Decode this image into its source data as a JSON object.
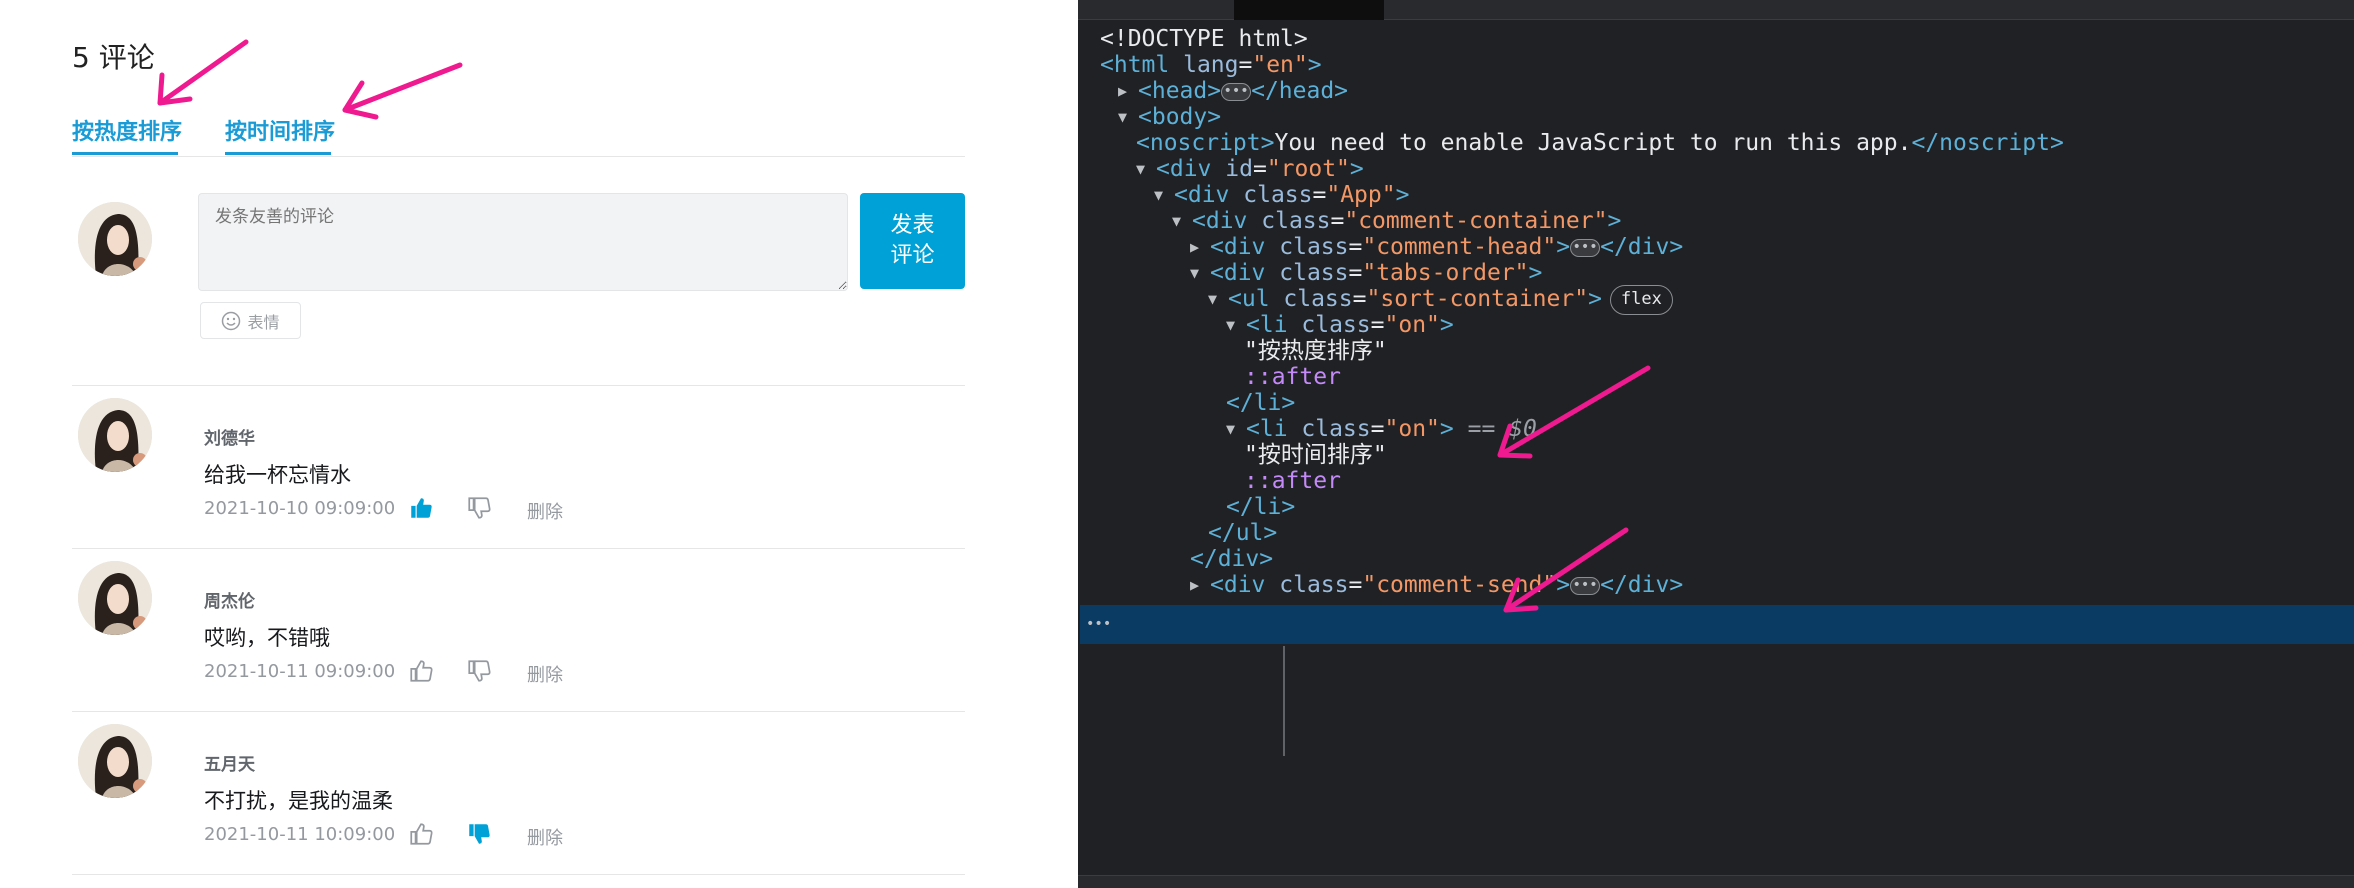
{
  "comment_section": {
    "count_label": "5 评论",
    "tabs": [
      {
        "label": "按热度排序"
      },
      {
        "label": "按时间排序"
      }
    ],
    "input": {
      "placeholder": "发条友善的评论"
    },
    "publish_label": "发表\n评论",
    "emoji_label": "表情",
    "delete_label": "删除",
    "comments": [
      {
        "user": "刘德华",
        "text": "给我一杯忘情水",
        "time": "2021-10-10 09:09:00",
        "liked": true,
        "disliked": false
      },
      {
        "user": "周杰伦",
        "text": "哎哟，不错哦",
        "time": "2021-10-11 09:09:00",
        "liked": false,
        "disliked": false
      },
      {
        "user": "五月天",
        "text": "不打扰，是我的温柔",
        "time": "2021-10-11 10:09:00",
        "liked": false,
        "disliked": true
      }
    ],
    "accent_color": "#00a1d6"
  },
  "devtools": {
    "lines": [
      [
        [
          "p",
          "<!DOCTYPE html>"
        ]
      ],
      [
        [
          "t",
          "<html "
        ],
        [
          "n",
          "lang"
        ],
        [
          "p",
          "="
        ],
        [
          "v",
          "\"en\""
        ],
        [
          "t",
          ">"
        ]
      ],
      [
        [
          "t",
          "<head>"
        ],
        [
          "d",
          "…"
        ],
        [
          "t",
          "</head>"
        ]
      ],
      [
        [
          "t",
          "<body>"
        ]
      ],
      [
        [
          "t",
          "<noscript>"
        ],
        [
          "p",
          "You need to enable JavaScript to run this app."
        ],
        [
          "t",
          "</noscript>"
        ]
      ],
      [
        [
          "t",
          "<div "
        ],
        [
          "n",
          "id"
        ],
        [
          "p",
          "="
        ],
        [
          "v",
          "\"root\""
        ],
        [
          "t",
          ">"
        ]
      ],
      [
        [
          "t",
          "<div "
        ],
        [
          "n",
          "class"
        ],
        [
          "p",
          "="
        ],
        [
          "v",
          "\"App\""
        ],
        [
          "t",
          ">"
        ]
      ],
      [
        [
          "t",
          "<div "
        ],
        [
          "n",
          "class"
        ],
        [
          "p",
          "="
        ],
        [
          "v",
          "\"comment-container\""
        ],
        [
          "t",
          ">"
        ]
      ],
      [
        [
          "t",
          "<div "
        ],
        [
          "n",
          "class"
        ],
        [
          "p",
          "="
        ],
        [
          "v",
          "\"comment-head\""
        ],
        [
          "t",
          ">"
        ],
        [
          "d",
          "…"
        ],
        [
          "t",
          "</div>"
        ]
      ],
      [
        [
          "t",
          "<div "
        ],
        [
          "n",
          "class"
        ],
        [
          "p",
          "="
        ],
        [
          "v",
          "\"tabs-order\""
        ],
        [
          "t",
          ">"
        ]
      ],
      [
        [
          "t",
          "<ul "
        ],
        [
          "n",
          "class"
        ],
        [
          "p",
          "="
        ],
        [
          "v",
          "\"sort-container\""
        ],
        [
          "t",
          ">"
        ],
        [
          "b",
          "flex"
        ]
      ],
      [
        [
          "t",
          "<li "
        ],
        [
          "n",
          "class"
        ],
        [
          "p",
          "="
        ],
        [
          "v",
          "\"on\""
        ],
        [
          "t",
          ">"
        ]
      ],
      [
        [
          "p",
          "\"按热度排序\""
        ]
      ],
      [
        [
          "s",
          "::after"
        ]
      ],
      [
        [
          "t",
          "</li>"
        ]
      ],
      [
        [
          "t",
          "<li "
        ],
        [
          "n",
          "class"
        ],
        [
          "p",
          "="
        ],
        [
          "v",
          "\"on\""
        ],
        [
          "t",
          ">"
        ],
        [
          "c",
          " == $0"
        ]
      ],
      [
        [
          "p",
          "\"按时间排序\""
        ]
      ],
      [
        [
          "s",
          "::after"
        ]
      ],
      [
        [
          "t",
          "</li>"
        ]
      ],
      [
        [
          "t",
          "</ul>"
        ]
      ],
      [
        [
          "t",
          "</div>"
        ]
      ],
      [
        [
          "t",
          "<div "
        ],
        [
          "n",
          "class"
        ],
        [
          "p",
          "="
        ],
        [
          "v",
          "\"comment-send\""
        ],
        [
          "t",
          ">"
        ],
        [
          "d",
          "…"
        ],
        [
          "t",
          "</div>"
        ]
      ]
    ],
    "ellipsis_marker": "•••"
  }
}
